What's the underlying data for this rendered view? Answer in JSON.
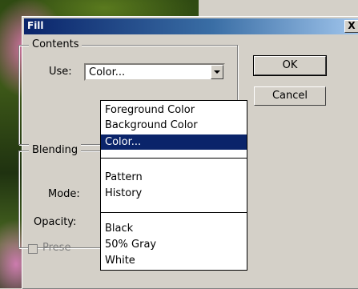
{
  "window": {
    "title": "Fill",
    "close_label": "X"
  },
  "contents": {
    "group_label": "Contents",
    "use_label": "Use:",
    "use_value": "Color..."
  },
  "blending": {
    "group_label": "Blending",
    "mode_label": "Mode:",
    "opacity_label": "Opacity:",
    "preserve_label": "Prese"
  },
  "buttons": {
    "ok": "OK",
    "cancel": "Cancel"
  },
  "dropdown": {
    "items": [
      "Foreground Color",
      "Background Color",
      "Color...",
      "Pattern",
      "History",
      "Black",
      "50% Gray",
      "White"
    ],
    "selected": "Color..."
  }
}
